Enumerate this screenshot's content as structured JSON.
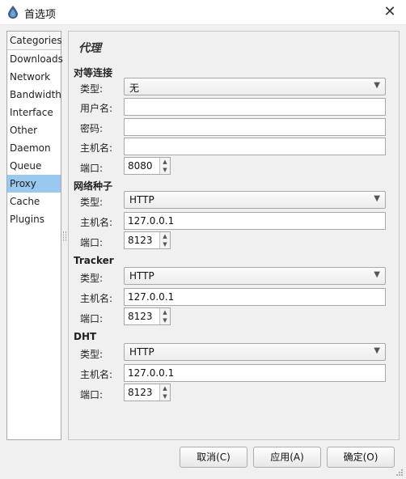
{
  "window": {
    "title": "首选项",
    "app_icon": "deluge-droplet-icon"
  },
  "sidebar": {
    "header": "Categories",
    "items": [
      {
        "label": "Downloads"
      },
      {
        "label": "Network"
      },
      {
        "label": "Bandwidth"
      },
      {
        "label": "Interface"
      },
      {
        "label": "Other"
      },
      {
        "label": "Daemon"
      },
      {
        "label": "Queue"
      },
      {
        "label": "Proxy",
        "selected": true
      },
      {
        "label": "Cache"
      },
      {
        "label": "Plugins"
      }
    ]
  },
  "panel": {
    "title": "代理",
    "peer": {
      "heading": "对等连接",
      "type_label": "类型:",
      "type_value": "无",
      "username_label": "用户名:",
      "username_value": "",
      "password_label": "密码:",
      "password_value": "",
      "host_label": "主机名:",
      "host_value": "",
      "port_label": "端口:",
      "port_value": "8080"
    },
    "web_seed": {
      "heading": "网络种子",
      "type_label": "类型:",
      "type_value": "HTTP",
      "host_label": "主机名:",
      "host_value": "127.0.0.1",
      "port_label": "端口:",
      "port_value": "8123"
    },
    "tracker": {
      "heading": "Tracker",
      "type_label": "类型:",
      "type_value": "HTTP",
      "host_label": "主机名:",
      "host_value": "127.0.0.1",
      "port_label": "端口:",
      "port_value": "8123"
    },
    "dht": {
      "heading": "DHT",
      "type_label": "类型:",
      "type_value": "HTTP",
      "host_label": "主机名:",
      "host_value": "127.0.0.1",
      "port_label": "端口:",
      "port_value": "8123"
    }
  },
  "buttons": {
    "cancel": "取消(C)",
    "apply": "应用(A)",
    "ok": "确定(O)"
  },
  "colors": {
    "selected_item": "#99c9ef",
    "window_bg": "#f0f0f0"
  }
}
